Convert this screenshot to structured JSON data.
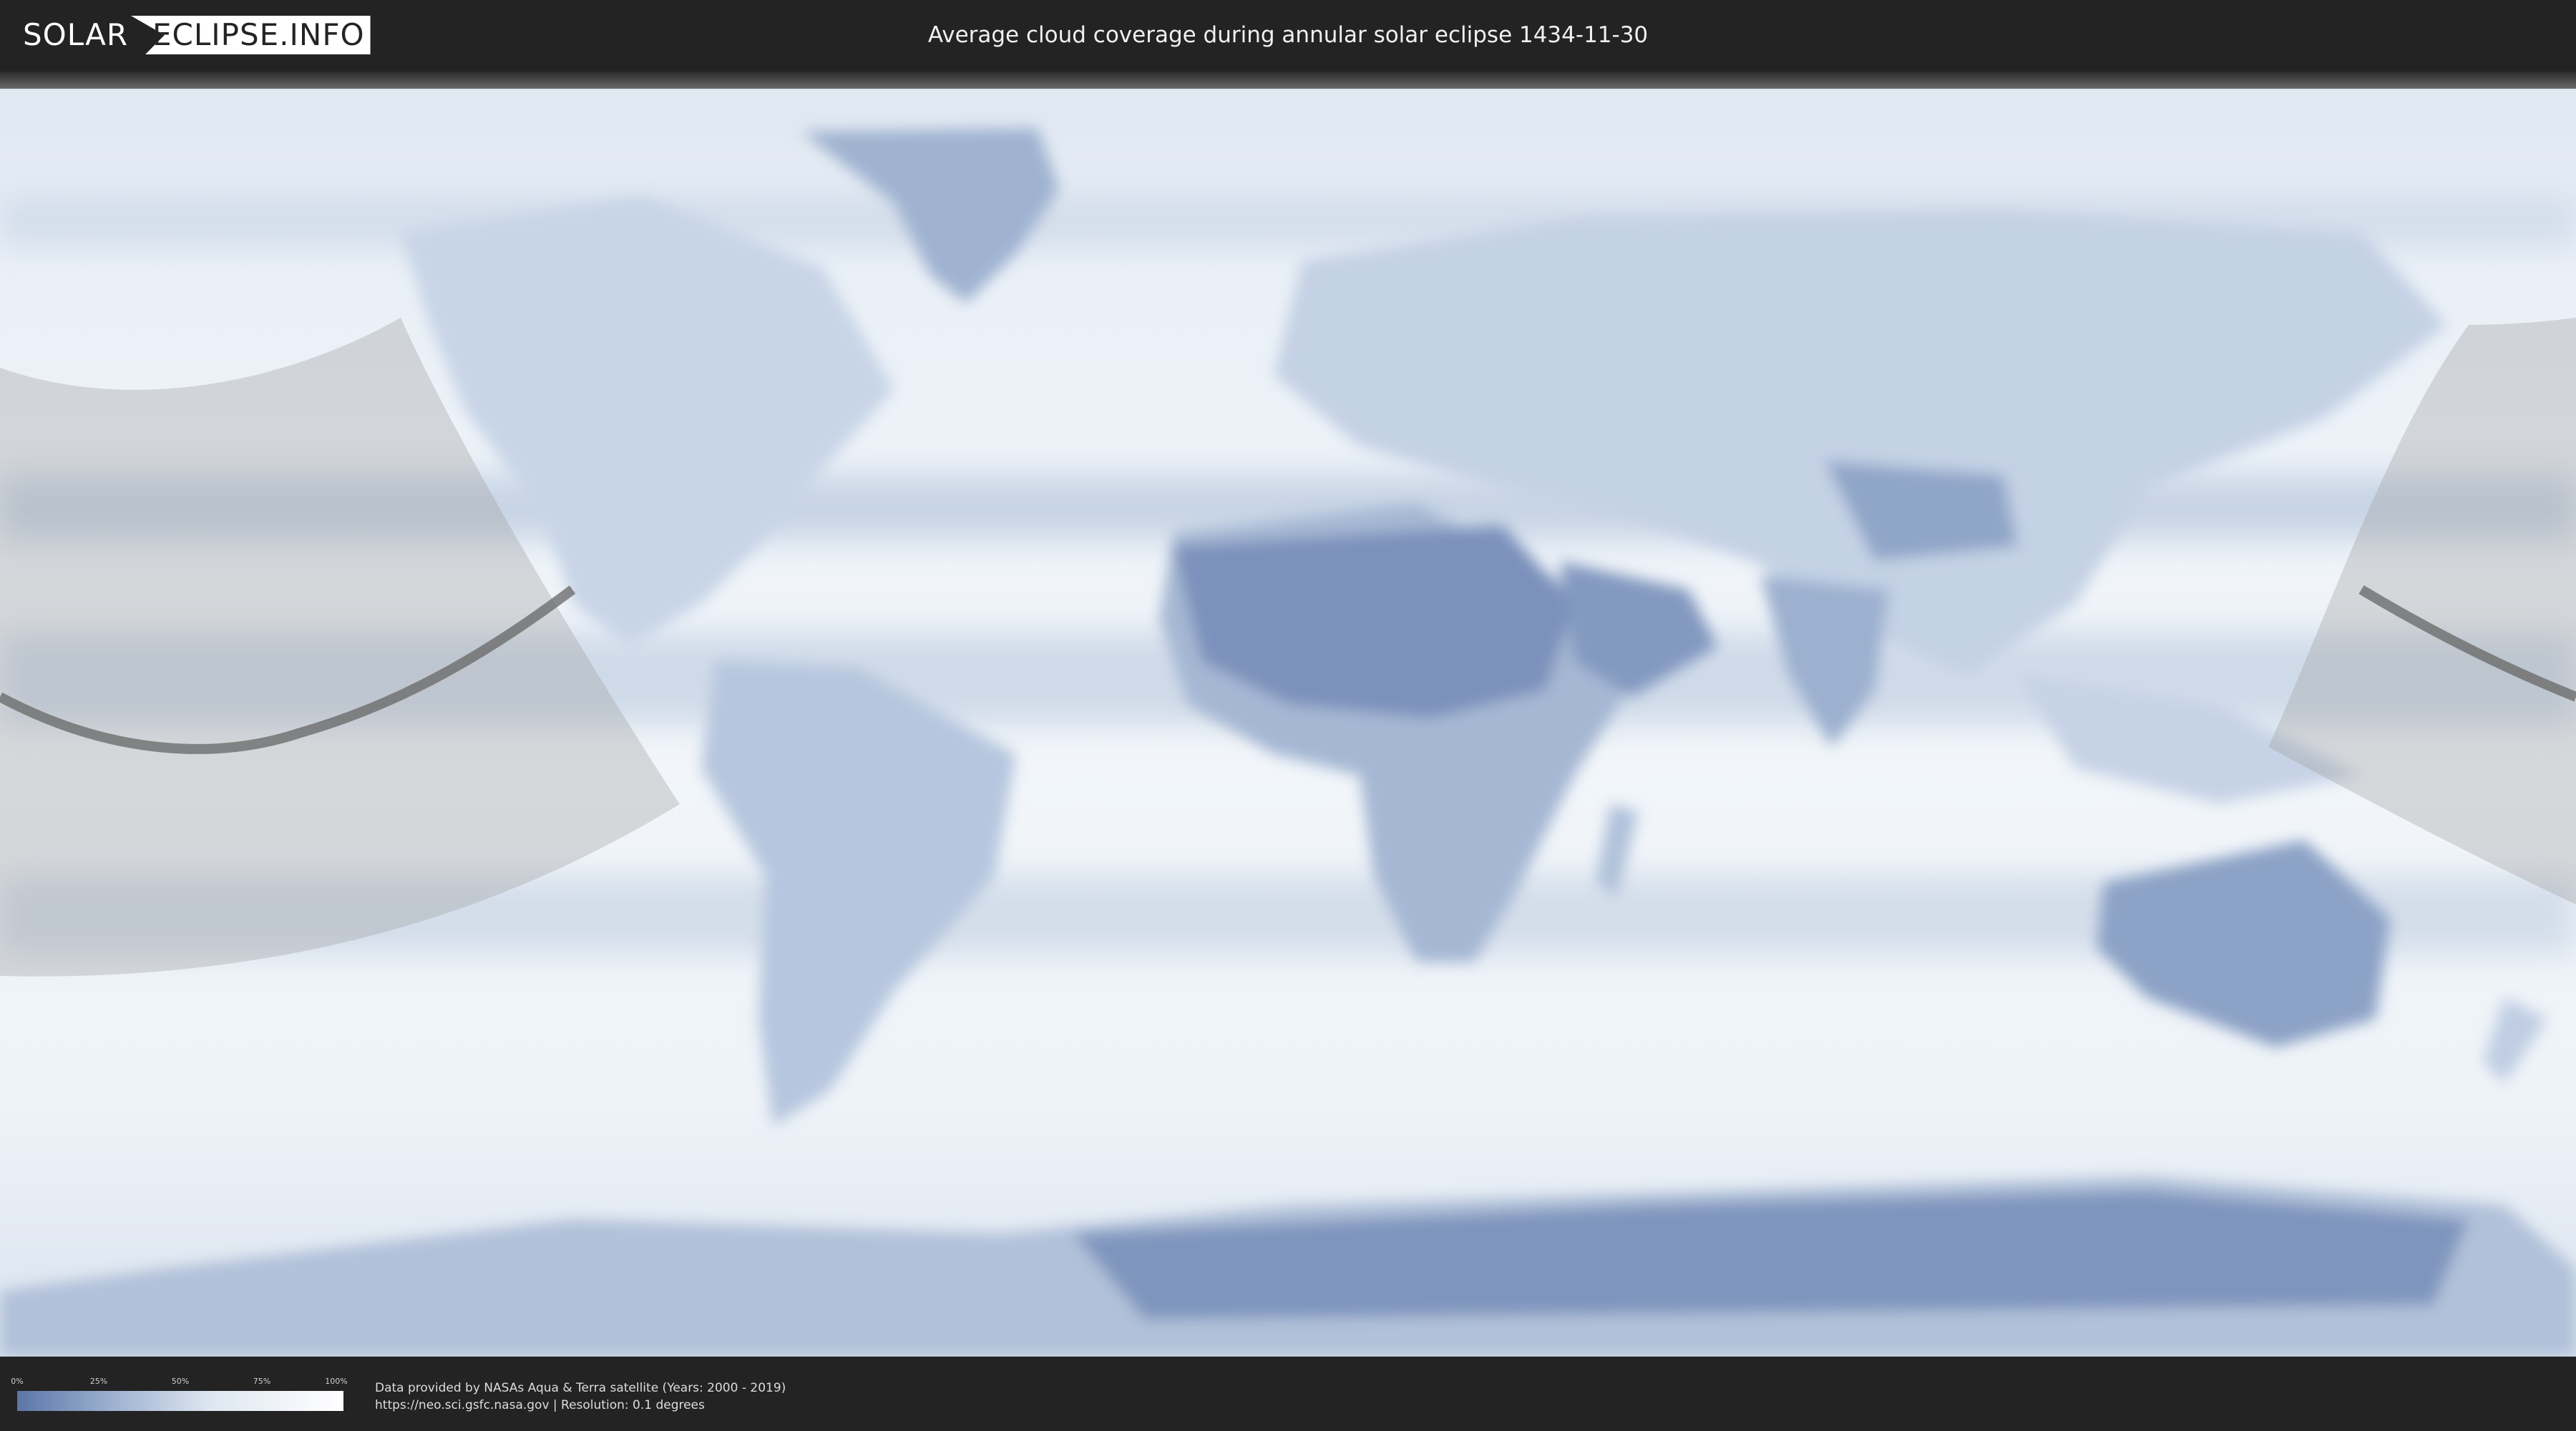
{
  "header": {
    "logo_left": "SOLAR",
    "logo_right": "ECLIPSE.INFO",
    "title": "Average cloud coverage during annular solar eclipse 1434-11-30"
  },
  "legend": {
    "ticks": [
      "0%",
      "25%",
      "50%",
      "75%",
      "100%"
    ],
    "color_low": "#5b76a8",
    "color_high": "#ffffff"
  },
  "footer": {
    "credit_line": "Data provided by NASAs Aqua & Terra satellite (Years: 2000 - 2019)",
    "source_line": "https://neo.sci.gsfc.nasa.gov | Resolution: 0.1 degrees"
  },
  "colors": {
    "background": "#232323",
    "ocean_cloud": "#eef3f9",
    "land_clear": "#7d94bd",
    "eclipse_zone": "#9a9a9a",
    "central_line": "#666666"
  }
}
